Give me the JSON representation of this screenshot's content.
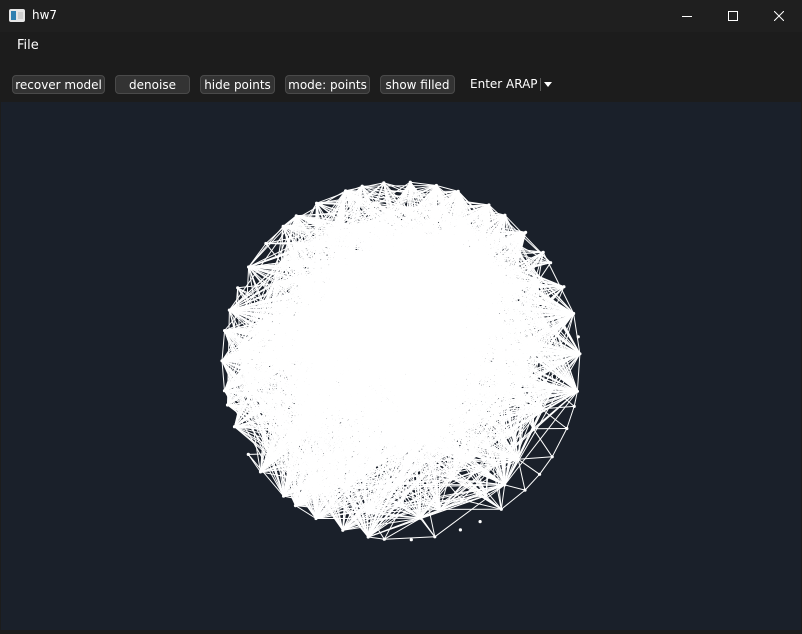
{
  "window": {
    "title": "hw7"
  },
  "menu": {
    "file_label": "File"
  },
  "toolbar": {
    "recover_label": "recover model",
    "denoise_label": "denoise",
    "hide_points_label": "hide points",
    "mode_label": "mode: points",
    "show_filled_label": "show filled",
    "arap_selected": "Enter ARAP"
  },
  "canvas": {
    "background": "#1a202a",
    "mesh_color": "#ffffff"
  },
  "icons": {
    "app": "app-window-icon",
    "minimize": "minimize-icon",
    "maximize": "maximize-icon",
    "close": "close-icon",
    "dropdown": "chevron-down-icon"
  }
}
